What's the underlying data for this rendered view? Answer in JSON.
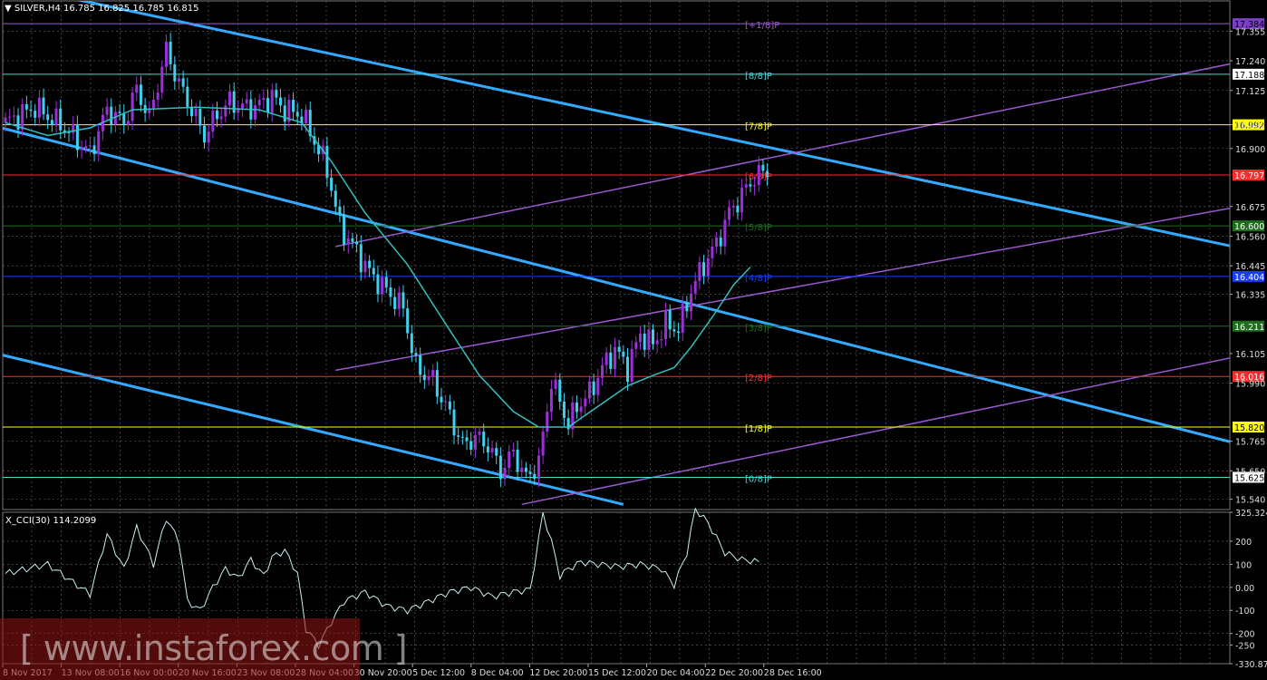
{
  "header": {
    "symbol_line": "SILVER,H4  16.785 16.825 16.785 16.815",
    "indicator_line": "X_CCI(30) 114.2099"
  },
  "watermark": "[ www.instaforex.com ]",
  "chart_data": [
    {
      "type": "candlestick",
      "title": "SILVER,H4",
      "ylim": [
        15.5,
        17.43
      ],
      "y_ticks": [
        "17.355",
        "17.240",
        "17.125",
        "16.992",
        "16.900",
        "16.675",
        "16.560",
        "16.445",
        "16.335",
        "16.105",
        "15.990",
        "15.765",
        "15.650",
        "15.540"
      ],
      "x_ticks": [
        "8 Nov 2017",
        "13 Nov 08:00",
        "16 Nov 00:00",
        "20 Nov 16:00",
        "23 Nov 08:00",
        "28 Nov 04:00",
        "30 Nov 20:00",
        "5 Dec 12:00",
        "8 Dec 04:00",
        "12 Dec 20:00",
        "15 Dec 12:00",
        "20 Dec 04:00",
        "22 Dec 20:00",
        "28 Dec 16:00"
      ],
      "price_path": [
        [
          0,
          17.0
        ],
        [
          7,
          17.06
        ],
        [
          14,
          16.98
        ],
        [
          20,
          16.88
        ],
        [
          24,
          17.05
        ],
        [
          28,
          17.0
        ],
        [
          31,
          17.13
        ],
        [
          34,
          17.02
        ],
        [
          38,
          17.28
        ],
        [
          41,
          17.15
        ],
        [
          44,
          17.05
        ],
        [
          47,
          16.95
        ],
        [
          50,
          17.03
        ],
        [
          53,
          17.08
        ],
        [
          56,
          17.06
        ],
        [
          59,
          17.06
        ],
        [
          63,
          17.1
        ],
        [
          66,
          17.05
        ],
        [
          70,
          17.03
        ],
        [
          73,
          16.93
        ],
        [
          76,
          16.82
        ],
        [
          79,
          16.6
        ],
        [
          83,
          16.5
        ],
        [
          86,
          16.42
        ],
        [
          90,
          16.35
        ],
        [
          94,
          16.28
        ],
        [
          97,
          16.05
        ],
        [
          101,
          16.0
        ],
        [
          104,
          15.9
        ],
        [
          108,
          15.75
        ],
        [
          111,
          15.78
        ],
        [
          114,
          15.75
        ],
        [
          117,
          15.65
        ],
        [
          120,
          15.72
        ],
        [
          123,
          15.62
        ],
        [
          126,
          15.68
        ],
        [
          129,
          16.0
        ],
        [
          131,
          15.92
        ],
        [
          133,
          15.83
        ],
        [
          135,
          15.9
        ],
        [
          138,
          15.95
        ],
        [
          141,
          16.05
        ],
        [
          144,
          16.12
        ],
        [
          147,
          16.05
        ],
        [
          150,
          16.18
        ],
        [
          153,
          16.14
        ],
        [
          156,
          16.22
        ],
        [
          159,
          16.2
        ],
        [
          162,
          16.35
        ],
        [
          165,
          16.45
        ],
        [
          168,
          16.53
        ],
        [
          171,
          16.65
        ],
        [
          174,
          16.72
        ],
        [
          177,
          16.79
        ],
        [
          180,
          16.815
        ]
      ],
      "ma_path": [
        [
          0,
          17.0
        ],
        [
          10,
          16.95
        ],
        [
          20,
          16.98
        ],
        [
          30,
          17.05
        ],
        [
          45,
          17.06
        ],
        [
          60,
          17.05
        ],
        [
          70,
          17.0
        ],
        [
          77,
          16.85
        ],
        [
          85,
          16.65
        ],
        [
          95,
          16.45
        ],
        [
          104,
          16.22
        ],
        [
          112,
          16.02
        ],
        [
          120,
          15.88
        ],
        [
          126,
          15.82
        ],
        [
          133,
          15.82
        ],
        [
          140,
          15.9
        ],
        [
          147,
          15.98
        ],
        [
          153,
          16.02
        ],
        [
          158,
          16.05
        ],
        [
          162,
          16.13
        ],
        [
          168,
          16.27
        ],
        [
          172,
          16.37
        ],
        [
          176,
          16.44
        ]
      ],
      "murrey_levels": [
        {
          "label": "[+1/8]P",
          "value": "17.384",
          "price": 17.384,
          "color": "#9b59d0",
          "box": "#7b3fc4",
          "text_color": "#000"
        },
        {
          "label": "[8/8]P",
          "value": "17.188",
          "price": 17.188,
          "color": "#4fd3d3",
          "box": "#ffffff",
          "text_color": "#000"
        },
        {
          "label": "[7/8]P",
          "value": "16.992",
          "price": 16.992,
          "color": "#ffff00",
          "box": "#ffff00",
          "text_color": "#000"
        },
        {
          "label": "[6/8]P",
          "value": "16.797",
          "price": 16.797,
          "color": "#ff2a2a",
          "box": "#ff2a2a",
          "text_color": "#fff"
        },
        {
          "label": "[5/8]P",
          "value": "16.600",
          "price": 16.6,
          "color": "#1e6e1e",
          "box": "#1e6e1e",
          "text_color": "#fff"
        },
        {
          "label": "[4/8]P",
          "value": "16.404",
          "price": 16.404,
          "color": "#1a3cff",
          "box": "#1a3cff",
          "text_color": "#fff"
        },
        {
          "label": "[3/8]P",
          "value": "16.211",
          "price": 16.211,
          "color": "#1e6e1e",
          "box": "#1e6e1e",
          "text_color": "#fff"
        },
        {
          "label": "[2/8]P",
          "value": "16.016",
          "price": 16.016,
          "color": "#ff2a2a",
          "box": "#ff2a2a",
          "text_color": "#fff"
        },
        {
          "label": "[1/8]P",
          "value": "15.820",
          "price": 15.82,
          "color": "#ffff00",
          "box": "#ffff00",
          "text_color": "#000"
        },
        {
          "label": "[0/8]P",
          "value": "15.625",
          "price": 15.625,
          "color": "#4fd3d3",
          "box": "#ffffff",
          "text_color": "#000"
        }
      ],
      "colors": {
        "bull": "#9b30d9",
        "bear": "#3fd0ee",
        "ma": "#33bfbf",
        "channel_down": "#33aaff",
        "channel_up": "#9b59d0"
      }
    },
    {
      "type": "line",
      "title": "X_CCI(30) 114.2099",
      "ylim": [
        -330.875,
        325.3242
      ],
      "y_ticks": [
        "325.3242",
        "200",
        "100",
        "0.00",
        "-100",
        "-200",
        "-250",
        "-330.875"
      ],
      "values_path": [
        [
          0,
          60
        ],
        [
          10,
          100
        ],
        [
          20,
          -30
        ],
        [
          24,
          230
        ],
        [
          28,
          80
        ],
        [
          31,
          260
        ],
        [
          35,
          100
        ],
        [
          38,
          300
        ],
        [
          41,
          200
        ],
        [
          43,
          -60
        ],
        [
          46,
          -100
        ],
        [
          49,
          0
        ],
        [
          52,
          80
        ],
        [
          55,
          40
        ],
        [
          58,
          120
        ],
        [
          61,
          50
        ],
        [
          63,
          130
        ],
        [
          66,
          160
        ],
        [
          69,
          60
        ],
        [
          71,
          -180
        ],
        [
          74,
          -250
        ],
        [
          77,
          -150
        ],
        [
          80,
          -60
        ],
        [
          85,
          -20
        ],
        [
          90,
          -80
        ],
        [
          95,
          -100
        ],
        [
          100,
          -60
        ],
        [
          105,
          -20
        ],
        [
          110,
          0
        ],
        [
          115,
          -40
        ],
        [
          120,
          -20
        ],
        [
          124,
          -10
        ],
        [
          127,
          320
        ],
        [
          129,
          200
        ],
        [
          131,
          50
        ],
        [
          133,
          80
        ],
        [
          136,
          110
        ],
        [
          140,
          100
        ],
        [
          145,
          90
        ],
        [
          150,
          100
        ],
        [
          155,
          80
        ],
        [
          158,
          10
        ],
        [
          161,
          150
        ],
        [
          163,
          340
        ],
        [
          166,
          280
        ],
        [
          170,
          150
        ],
        [
          174,
          120
        ],
        [
          178,
          110
        ]
      ],
      "color": "#c8f0f0"
    }
  ]
}
